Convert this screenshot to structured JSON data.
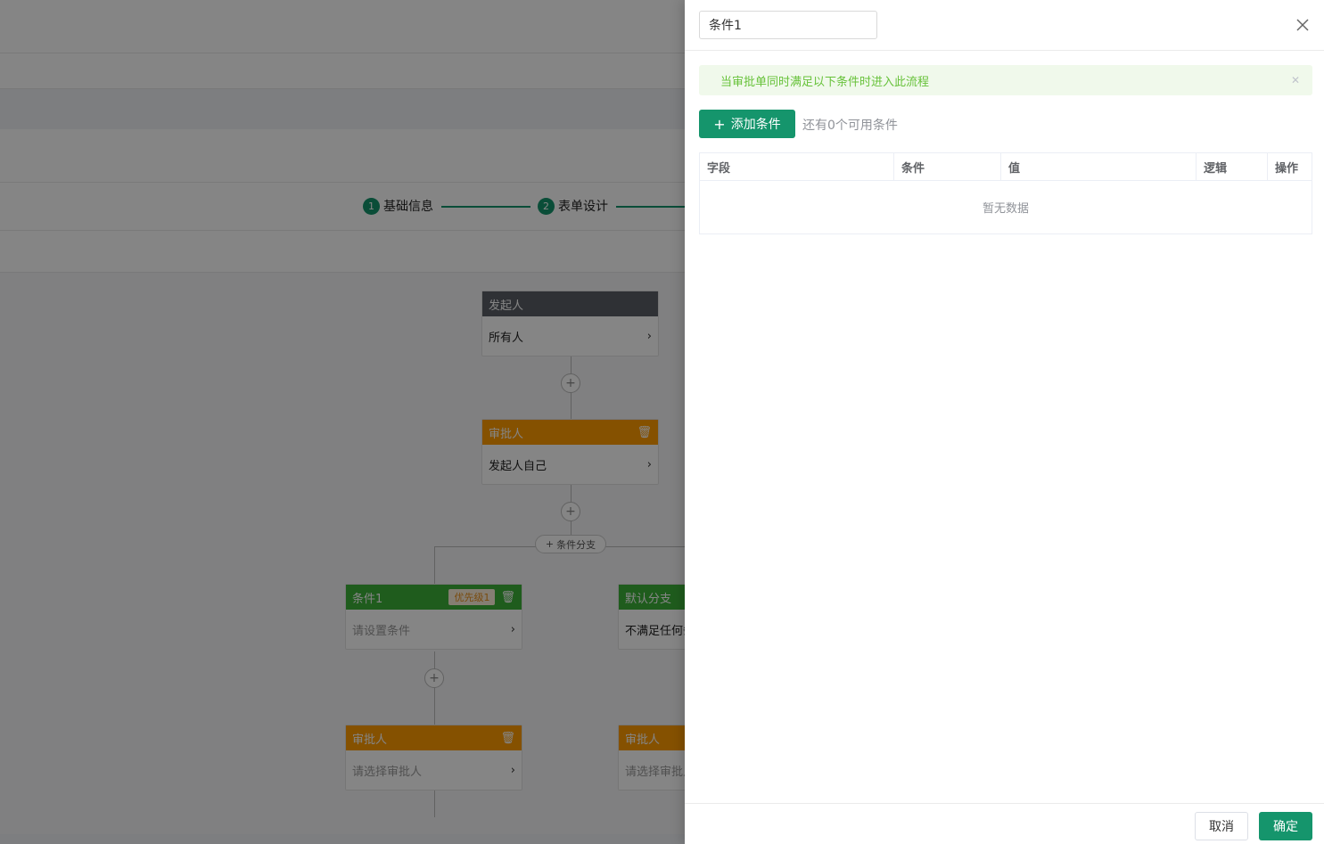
{
  "background": {
    "steps": [
      {
        "num": "1",
        "label": "基础信息"
      },
      {
        "num": "2",
        "label": "表单设计"
      }
    ],
    "nodes": {
      "initiator": {
        "title": "发起人",
        "body": "所有人"
      },
      "approver1": {
        "title": "审批人",
        "body": "发起人自己"
      },
      "branch_button": "条件分支",
      "condition1": {
        "title": "条件1",
        "priority": "优先级1",
        "body": "请设置条件"
      },
      "default_branch": {
        "title": "默认分支",
        "body": "不满足任何条"
      },
      "approver2": {
        "title": "审批人",
        "body": "请选择审批人"
      },
      "approver3": {
        "title": "审批人",
        "body": "请选择审批人"
      }
    }
  },
  "drawer": {
    "title_value": "条件1",
    "alert_text": "当审批单同时满足以下条件时进入此流程",
    "add_button_label": "添加条件",
    "available_hint": "还有0个可用条件",
    "table": {
      "columns": [
        "字段",
        "条件",
        "值",
        "逻辑",
        "操作"
      ],
      "empty_text": "暂无数据"
    },
    "footer": {
      "cancel_label": "取消",
      "confirm_label": "确定"
    }
  },
  "colors": {
    "primary": "#15956c",
    "approver": "#ff9b00",
    "condition": "#3cb038",
    "initiator": "#5a5e66",
    "alert_bg": "#f0f9eb",
    "alert_text": "#67c23a"
  }
}
